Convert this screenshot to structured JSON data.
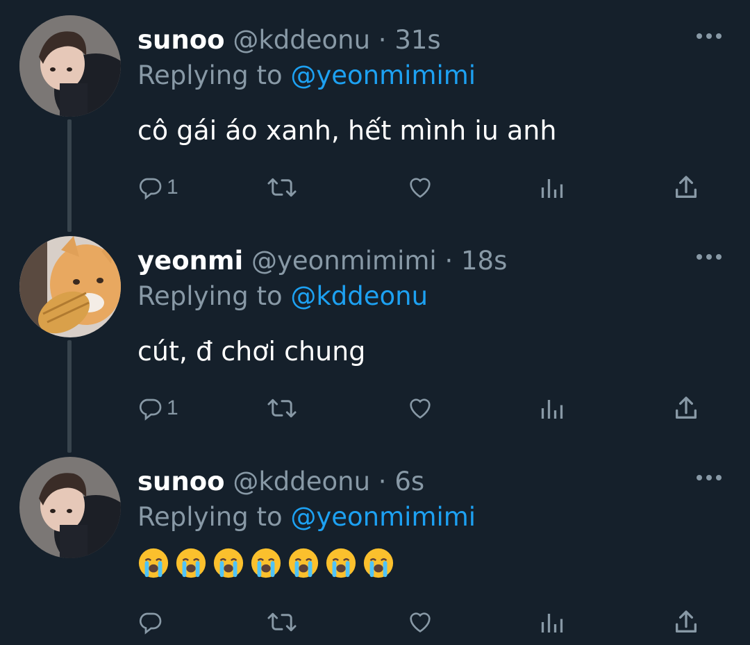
{
  "colors": {
    "background": "#15202b",
    "secondary_text": "#8899a6",
    "mention": "#1da1f2",
    "thread_line": "#38444d"
  },
  "tweets": [
    {
      "name": "sunoo",
      "handle": "@kddeonu",
      "separator": "·",
      "time": "31s",
      "replying_prefix": "Replying to",
      "replying_to": "@yeonmimimi",
      "text": "cô gái áo xanh, hết mình iu anh",
      "reply_count": "1",
      "avatar": "person-photo"
    },
    {
      "name": "yeonmi",
      "handle": "@yeonmimimi",
      "separator": "·",
      "time": "18s",
      "replying_prefix": "Replying to",
      "replying_to": "@kddeonu",
      "text": "cút, đ chơi chung",
      "reply_count": "1",
      "avatar": "cat-photo"
    },
    {
      "name": "sunoo",
      "handle": "@kddeonu",
      "separator": "·",
      "time": "6s",
      "replying_prefix": "Replying to",
      "replying_to": "@yeonmimimi",
      "text": "😭😭😭😭😭😭😭",
      "reply_count": "",
      "avatar": "person-photo"
    }
  ],
  "icons": {
    "reply": "reply-icon",
    "retweet": "retweet-icon",
    "like": "heart-icon",
    "analytics": "analytics-icon",
    "share": "share-icon",
    "more": "more-icon"
  }
}
